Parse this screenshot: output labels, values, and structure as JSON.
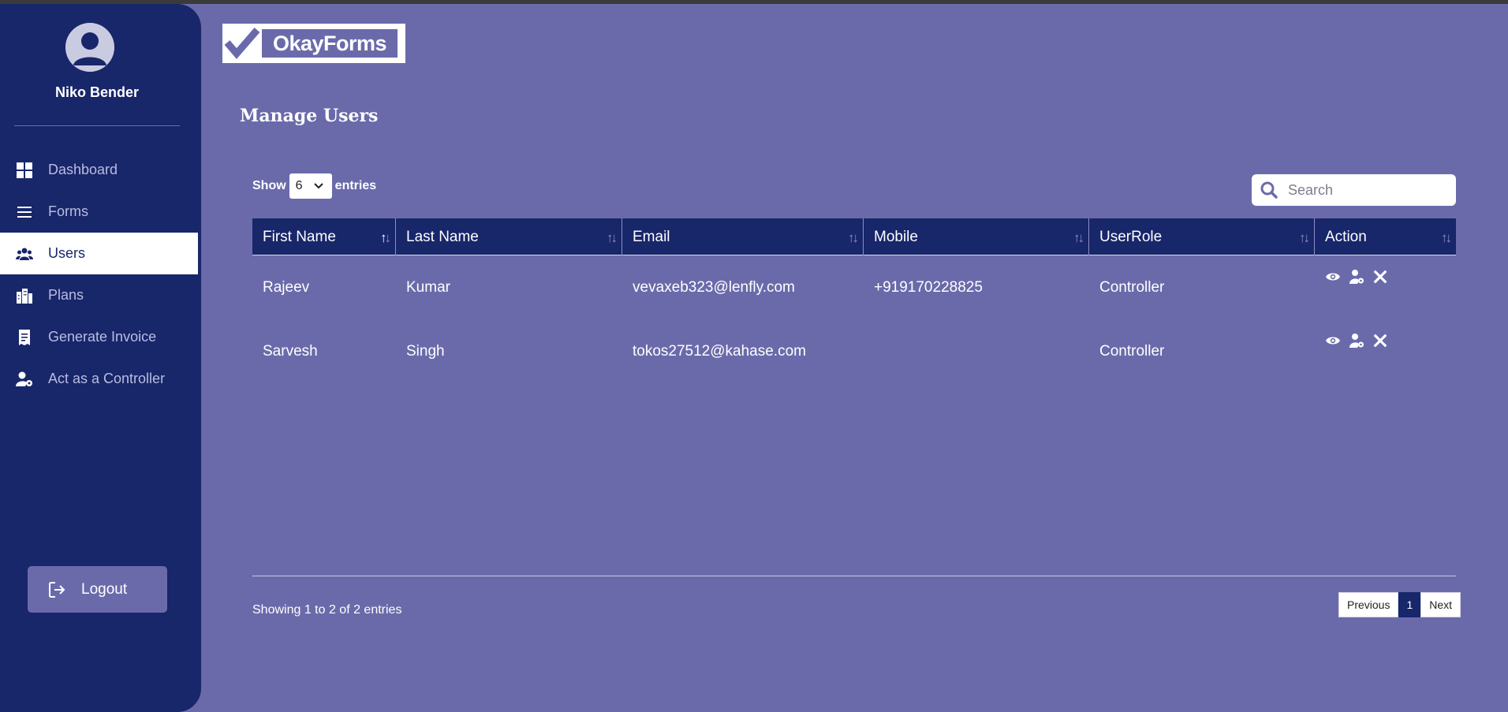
{
  "user": {
    "name": "Niko Bender"
  },
  "sidebar": {
    "items": [
      {
        "label": "Dashboard",
        "icon": "dashboard-icon",
        "active": false
      },
      {
        "label": "Forms",
        "icon": "menu-lines-icon",
        "active": false
      },
      {
        "label": "Users",
        "icon": "users-icon",
        "active": true
      },
      {
        "label": "Plans",
        "icon": "buildings-icon",
        "active": false
      },
      {
        "label": "Generate Invoice",
        "icon": "receipt-icon",
        "active": false
      },
      {
        "label": "Act as a Controller",
        "icon": "user-gear-icon",
        "active": false
      }
    ],
    "logout_label": "Logout"
  },
  "logo": {
    "text": "OkayForms"
  },
  "page": {
    "title": "Manage Users"
  },
  "table_controls": {
    "show_label": "Show",
    "entries_label": "entries",
    "page_length": "6",
    "search_placeholder": "Search"
  },
  "table": {
    "columns": [
      "First Name",
      "Last Name",
      "Email",
      "Mobile",
      "UserRole",
      "Action"
    ],
    "rows": [
      {
        "first_name": "Rajeev",
        "last_name": "Kumar",
        "email": "vevaxeb323@lenfly.com",
        "mobile": "+919170228825",
        "role": "Controller"
      },
      {
        "first_name": "Sarvesh",
        "last_name": "Singh",
        "email": "tokos27512@kahase.com",
        "mobile": "",
        "role": "Controller"
      }
    ]
  },
  "footer": {
    "info": "Showing 1 to 2 of 2 entries",
    "prev_label": "Previous",
    "current_page": "1",
    "next_label": "Next"
  },
  "colors": {
    "sidebar": "#18266a",
    "background": "#6a6aab",
    "header": "#18266a",
    "text": "#ffffff"
  }
}
